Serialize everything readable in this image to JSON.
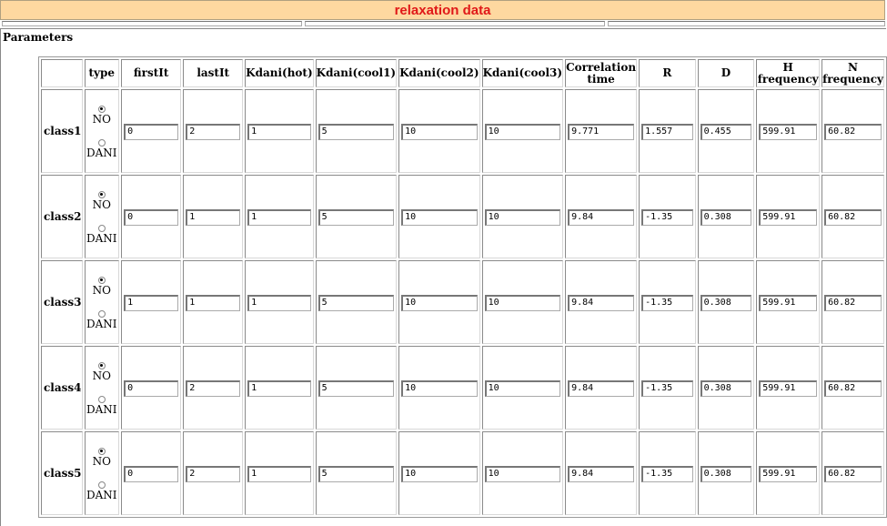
{
  "title": "relaxation data",
  "section_label": "Parameters",
  "headers": {
    "type": "type",
    "firstIt": "firstIt",
    "lastIt": "lastIt",
    "kdani_hot": "Kdani(hot)",
    "kdani_cool1": "Kdani(cool1)",
    "kdani_cool2": "Kdani(cool2)",
    "kdani_cool3": "Kdani(cool3)",
    "corr_1": "Correlation",
    "corr_2": "time",
    "R": "R",
    "D": "D",
    "hfreq_1": "H",
    "hfreq_2": "frequency",
    "nfreq_1": "N",
    "nfreq_2": "frequency"
  },
  "type_options": {
    "no": "NO",
    "dani": "DANI"
  },
  "rows": [
    {
      "label": "class1",
      "type_selected": "NO",
      "firstIt": "0",
      "lastIt": "2",
      "kdani_hot": "1",
      "kdani_cool1": "5",
      "kdani_cool2": "10",
      "kdani_cool3": "10",
      "corr_time": "9.771",
      "R": "1.557",
      "D": "0.455",
      "H_freq": "599.91",
      "N_freq": "60.82"
    },
    {
      "label": "class2",
      "type_selected": "NO",
      "firstIt": "0",
      "lastIt": "1",
      "kdani_hot": "1",
      "kdani_cool1": "5",
      "kdani_cool2": "10",
      "kdani_cool3": "10",
      "corr_time": "9.84",
      "R": "-1.35",
      "D": "0.308",
      "H_freq": "599.91",
      "N_freq": "60.82"
    },
    {
      "label": "class3",
      "type_selected": "NO",
      "firstIt": "1",
      "lastIt": "1",
      "kdani_hot": "1",
      "kdani_cool1": "5",
      "kdani_cool2": "10",
      "kdani_cool3": "10",
      "corr_time": "9.84",
      "R": "-1.35",
      "D": "0.308",
      "H_freq": "599.91",
      "N_freq": "60.82"
    },
    {
      "label": "class4",
      "type_selected": "NO",
      "firstIt": "0",
      "lastIt": "2",
      "kdani_hot": "1",
      "kdani_cool1": "5",
      "kdani_cool2": "10",
      "kdani_cool3": "10",
      "corr_time": "9.84",
      "R": "-1.35",
      "D": "0.308",
      "H_freq": "599.91",
      "N_freq": "60.82"
    },
    {
      "label": "class5",
      "type_selected": "NO",
      "firstIt": "0",
      "lastIt": "2",
      "kdani_hot": "1",
      "kdani_cool1": "5",
      "kdani_cool2": "10",
      "kdani_cool3": "10",
      "corr_time": "9.84",
      "R": "-1.35",
      "D": "0.308",
      "H_freq": "599.91",
      "N_freq": "60.82"
    }
  ]
}
